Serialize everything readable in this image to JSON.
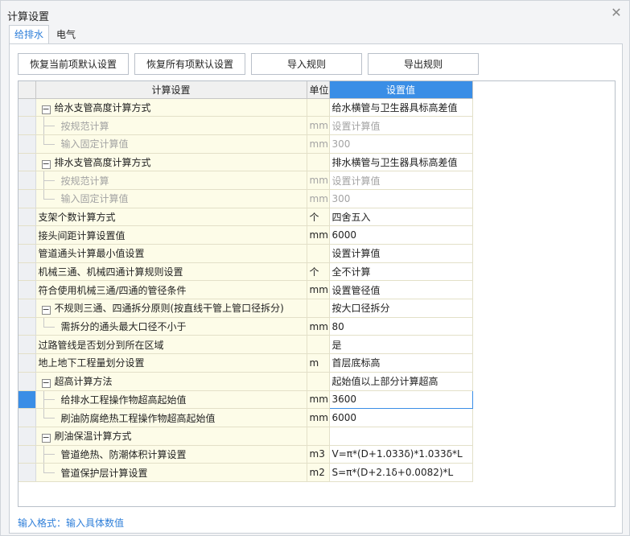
{
  "window": {
    "title": "计算设置",
    "close_glyph": "✕"
  },
  "tabs": [
    {
      "label": "给排水",
      "active": true
    },
    {
      "label": "电气",
      "active": false
    }
  ],
  "buttons": {
    "restore_current": "恢复当前项默认设置",
    "restore_all": "恢复所有项默认设置",
    "import_rules": "导入规则",
    "export_rules": "导出规则"
  },
  "grid": {
    "headers": {
      "name": "计算设置",
      "unit": "单位",
      "value": "设置值"
    },
    "rows": [
      {
        "name": "给水支管高度计算方式",
        "unit": "",
        "value": "给水横管与卫生器具标高差值"
      },
      {
        "name": "按规范计算",
        "unit": "mm",
        "value": "设置计算值"
      },
      {
        "name": "输入固定计算值",
        "unit": "mm",
        "value": "300"
      },
      {
        "name": "排水支管高度计算方式",
        "unit": "",
        "value": "排水横管与卫生器具标高差值"
      },
      {
        "name": "按规范计算",
        "unit": "mm",
        "value": "设置计算值"
      },
      {
        "name": "输入固定计算值",
        "unit": "mm",
        "value": "300"
      },
      {
        "name": "支架个数计算方式",
        "unit": "个",
        "value": "四舍五入"
      },
      {
        "name": "接头间距计算设置值",
        "unit": "mm",
        "value": "6000"
      },
      {
        "name": "管道通头计算最小值设置",
        "unit": "",
        "value": "设置计算值"
      },
      {
        "name": "机械三通、机械四通计算规则设置",
        "unit": "个",
        "value": "全不计算"
      },
      {
        "name": "符合使用机械三通/四通的管径条件",
        "unit": "mm",
        "value": "设置管径值"
      },
      {
        "name": "不规则三通、四通拆分原则(按直线干管上管口径拆分)",
        "unit": "",
        "value": "按大口径拆分"
      },
      {
        "name": "需拆分的通头最大口径不小于",
        "unit": "mm",
        "value": "80"
      },
      {
        "name": "过路管线是否划分到所在区域",
        "unit": "",
        "value": "是"
      },
      {
        "name": "地上地下工程量划分设置",
        "unit": "m",
        "value": "首层底标高"
      },
      {
        "name": "超高计算方法",
        "unit": "",
        "value": "起始值以上部分计算超高"
      },
      {
        "name": "给排水工程操作物超高起始值",
        "unit": "mm",
        "value": "3600"
      },
      {
        "name": "刷油防腐绝热工程操作物超高起始值",
        "unit": "mm",
        "value": "6000"
      },
      {
        "name": "刷油保温计算方式",
        "unit": "",
        "value": ""
      },
      {
        "name": "管道绝热、防潮体积计算设置",
        "unit": "m3",
        "value": "V=π*(D+1.033δ)*1.033δ*L"
      },
      {
        "name": "管道保护层计算设置",
        "unit": "m2",
        "value": "S=π*(D+2.1δ+0.0082)*L"
      }
    ]
  },
  "footer": {
    "hint": "输入格式：输入具体数值"
  },
  "colors": {
    "accent": "#3a8ee6",
    "name_bg": "#fdfce8",
    "hint": "#2f7fd9"
  }
}
